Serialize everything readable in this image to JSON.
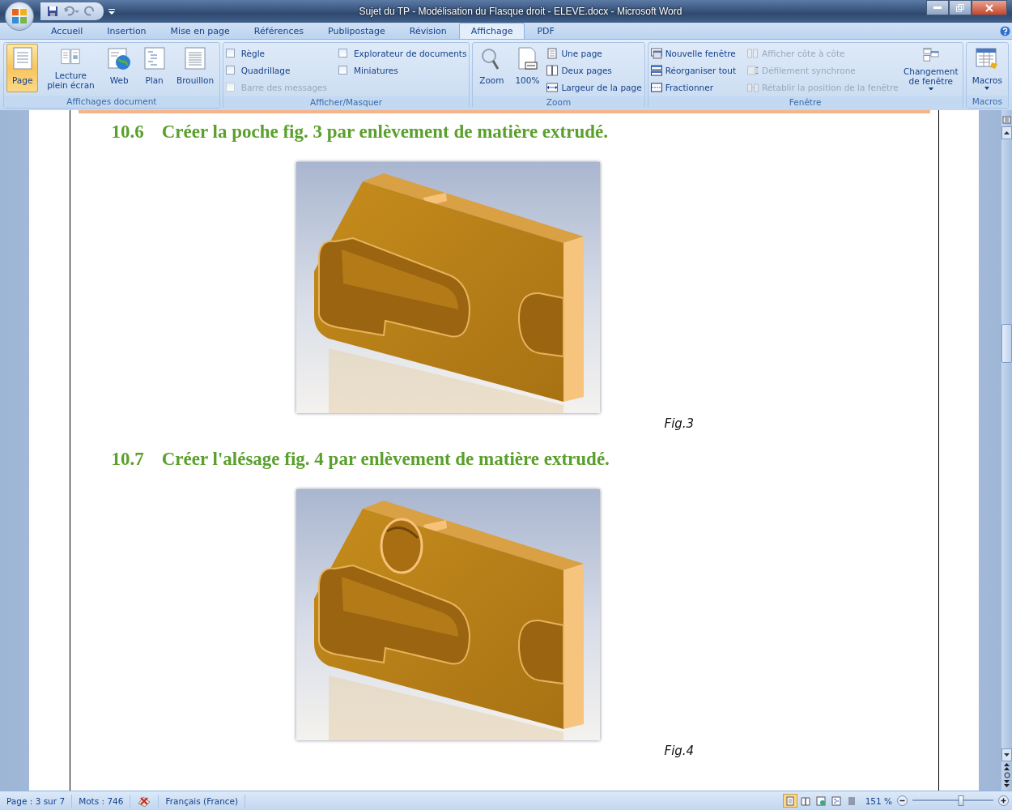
{
  "window": {
    "title": "Sujet du TP - Modélisation du Flasque droit - ELEVE.docx - Microsoft Word"
  },
  "tabs": [
    {
      "label": "Accueil",
      "selected": false
    },
    {
      "label": "Insertion",
      "selected": false
    },
    {
      "label": "Mise en page",
      "selected": false
    },
    {
      "label": "Références",
      "selected": false
    },
    {
      "label": "Publipostage",
      "selected": false
    },
    {
      "label": "Révision",
      "selected": false
    },
    {
      "label": "Affichage",
      "selected": true
    },
    {
      "label": "PDF",
      "selected": false
    }
  ],
  "ribbon": [
    {
      "label": "Affichages document",
      "items": [
        {
          "kind": "large",
          "label": "Page",
          "selected": true
        },
        {
          "kind": "large",
          "label": "Lecture plein écran",
          "selected": false
        },
        {
          "kind": "large",
          "label": "Web",
          "selected": false
        },
        {
          "kind": "large",
          "label": "Plan",
          "selected": false
        },
        {
          "kind": "large",
          "label": "Brouillon",
          "selected": false
        }
      ]
    },
    {
      "label": "Afficher/Masquer",
      "items": [
        {
          "kind": "check",
          "label": "Règle",
          "checked": false,
          "disabled": false
        },
        {
          "kind": "check",
          "label": "Quadrillage",
          "checked": false,
          "disabled": false
        },
        {
          "kind": "check",
          "label": "Barre des messages",
          "checked": false,
          "disabled": true
        },
        {
          "kind": "check",
          "label": "Explorateur de documents",
          "checked": false,
          "disabled": false
        },
        {
          "kind": "check",
          "label": "Miniatures",
          "checked": false,
          "disabled": false
        }
      ]
    },
    {
      "label": "Zoom",
      "items": [
        {
          "kind": "large",
          "label": "Zoom",
          "selected": false
        },
        {
          "kind": "large",
          "label": "100%",
          "selected": false
        },
        {
          "kind": "small",
          "label": "Une page",
          "disabled": false
        },
        {
          "kind": "small",
          "label": "Deux pages",
          "disabled": false
        },
        {
          "kind": "small",
          "label": "Largeur de la page",
          "disabled": false
        }
      ]
    },
    {
      "label": "Fenêtre",
      "items": [
        {
          "kind": "small",
          "label": "Nouvelle fenêtre",
          "disabled": false
        },
        {
          "kind": "small",
          "label": "Réorganiser tout",
          "disabled": false
        },
        {
          "kind": "small",
          "label": "Fractionner",
          "disabled": false
        },
        {
          "kind": "small",
          "label": "Afficher côte à côte",
          "disabled": true
        },
        {
          "kind": "small",
          "label": "Défilement synchrone",
          "disabled": true
        },
        {
          "kind": "small",
          "label": "Rétablir la position de la fenêtre",
          "disabled": true
        },
        {
          "kind": "large",
          "label": "Changement de fenêtre",
          "selected": false,
          "menu": true
        }
      ]
    },
    {
      "label": "Macros",
      "items": [
        {
          "kind": "large",
          "label": "Macros",
          "selected": false,
          "menu": true
        }
      ]
    }
  ],
  "document": {
    "sections": [
      {
        "number": "10.6",
        "heading": "Créer la poche fig. 3 par enlèvement de matière extrudé.",
        "caption": "Fig.3",
        "bore": false
      },
      {
        "number": "10.7",
        "heading": "Créer l'alésage fig. 4 par enlèvement de matière extrudé.",
        "caption": "Fig.4",
        "bore": true
      }
    ]
  },
  "status_bar": {
    "page": "Page : 3 sur 7",
    "words": "Mots : 746",
    "language": "Français (France)",
    "views": [
      {
        "selected": true
      },
      {
        "selected": false
      },
      {
        "selected": false
      },
      {
        "selected": false
      },
      {
        "selected": false
      }
    ],
    "zoom": "151 %",
    "zoom_slider": {
      "level": 0.6
    }
  }
}
